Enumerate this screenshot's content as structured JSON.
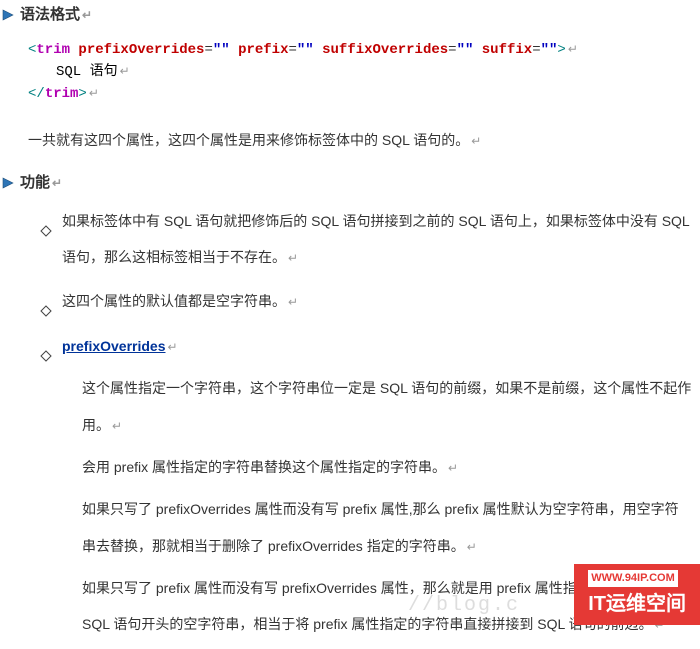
{
  "sections": {
    "syntax": {
      "title": "语法格式"
    },
    "function": {
      "title": "功能"
    }
  },
  "code": {
    "open_lt": "<",
    "tag": "trim",
    "attrs": [
      {
        "name": "prefixOverrides",
        "val": "\"\""
      },
      {
        "name": "prefix",
        "val": "\"\""
      },
      {
        "name": "suffixOverrides",
        "val": "\"\""
      },
      {
        "name": "suffix",
        "val": "\"\""
      }
    ],
    "open_gt": ">",
    "body": "SQL 语句",
    "close": "</",
    "close_gt": ">"
  },
  "para1": "一共就有这四个属性，这四个属性是用来修饰标签体中的 SQL 语句的。",
  "bullets": [
    {
      "text": "如果标签体中有 SQL 语句就把修饰后的 SQL 语句拼接到之前的 SQL 语句上，如果标签体中没有 SQL 语句，那么这相标签相当于不存在。"
    },
    {
      "text": "这四个属性的默认值都是空字符串。"
    },
    {
      "text_link": "prefixOverrides"
    }
  ],
  "subs": [
    "这个属性指定一个字符串，这个字符串位一定是 SQL 语句的前缀，如果不是前缀，这个属性不起作用。",
    "会用 prefix 属性指定的字符串替换这个属性指定的字符串。",
    "如果只写了 prefixOverrides 属性而没有写 prefix 属性,那么 prefix 属性默认为空字符串，用空字符串去替换，那就相当于删除了 prefixOverrides 指定的字符串。",
    "如果只写了 prefix 属性而没有写 prefixOverrides 属性，那么就是用 prefix 属性指定的字符串去替换 SQL 语句开头的空字符串，相当于将 prefix 属性指定的字符串直接拼接到 SQL 语句的前边。"
  ],
  "marks": {
    "soft": "↵",
    "para": "↵"
  },
  "watermark": "//blog.c",
  "banner": {
    "top": "WWW.94IP.COM",
    "main": "IT运维空间"
  }
}
